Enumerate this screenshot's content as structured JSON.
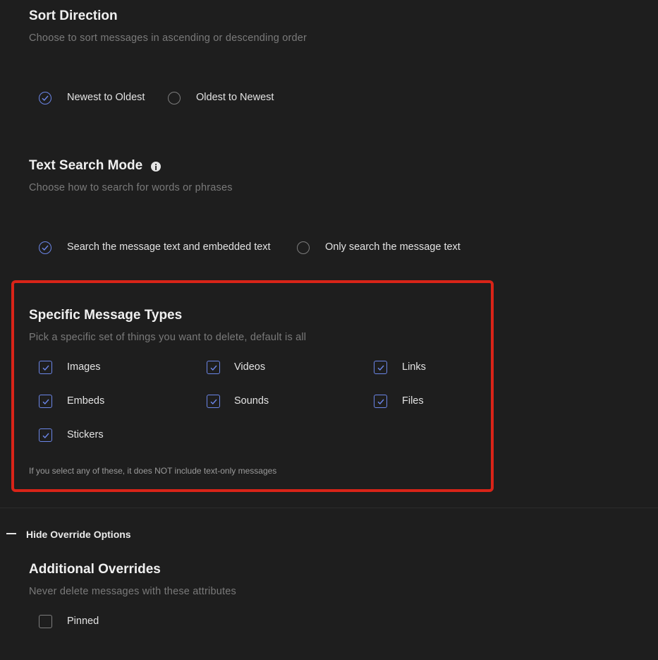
{
  "sort_direction": {
    "title": "Sort Direction",
    "description": "Choose to sort messages in ascending or descending order",
    "options": [
      {
        "label": "Newest to Oldest",
        "selected": true
      },
      {
        "label": "Oldest to Newest",
        "selected": false
      }
    ]
  },
  "text_search_mode": {
    "title": "Text Search Mode",
    "info_icon": "info-icon",
    "description": "Choose how to search for words or phrases",
    "options": [
      {
        "label": "Search the message text and embedded text",
        "selected": true
      },
      {
        "label": "Only search the message text",
        "selected": false
      }
    ]
  },
  "message_types": {
    "title": "Specific Message Types",
    "description": "Pick a specific set of things you want to delete, default is all",
    "items": [
      {
        "label": "Images",
        "checked": true
      },
      {
        "label": "Videos",
        "checked": true
      },
      {
        "label": "Links",
        "checked": true
      },
      {
        "label": "Embeds",
        "checked": true
      },
      {
        "label": "Sounds",
        "checked": true
      },
      {
        "label": "Files",
        "checked": true
      },
      {
        "label": "Stickers",
        "checked": true
      }
    ],
    "note": "If you select any of these, it does NOT include text-only messages",
    "highlight_color": "#d92418"
  },
  "override_toggle": {
    "label": "Hide Override Options",
    "icon": "minus-icon"
  },
  "additional_overrides": {
    "title": "Additional Overrides",
    "description": "Never delete messages with these attributes",
    "items": [
      {
        "label": "Pinned",
        "checked": false
      }
    ]
  },
  "colors": {
    "background": "#1e1e1e",
    "accent": "#6b86e8",
    "highlight": "#d92418"
  }
}
